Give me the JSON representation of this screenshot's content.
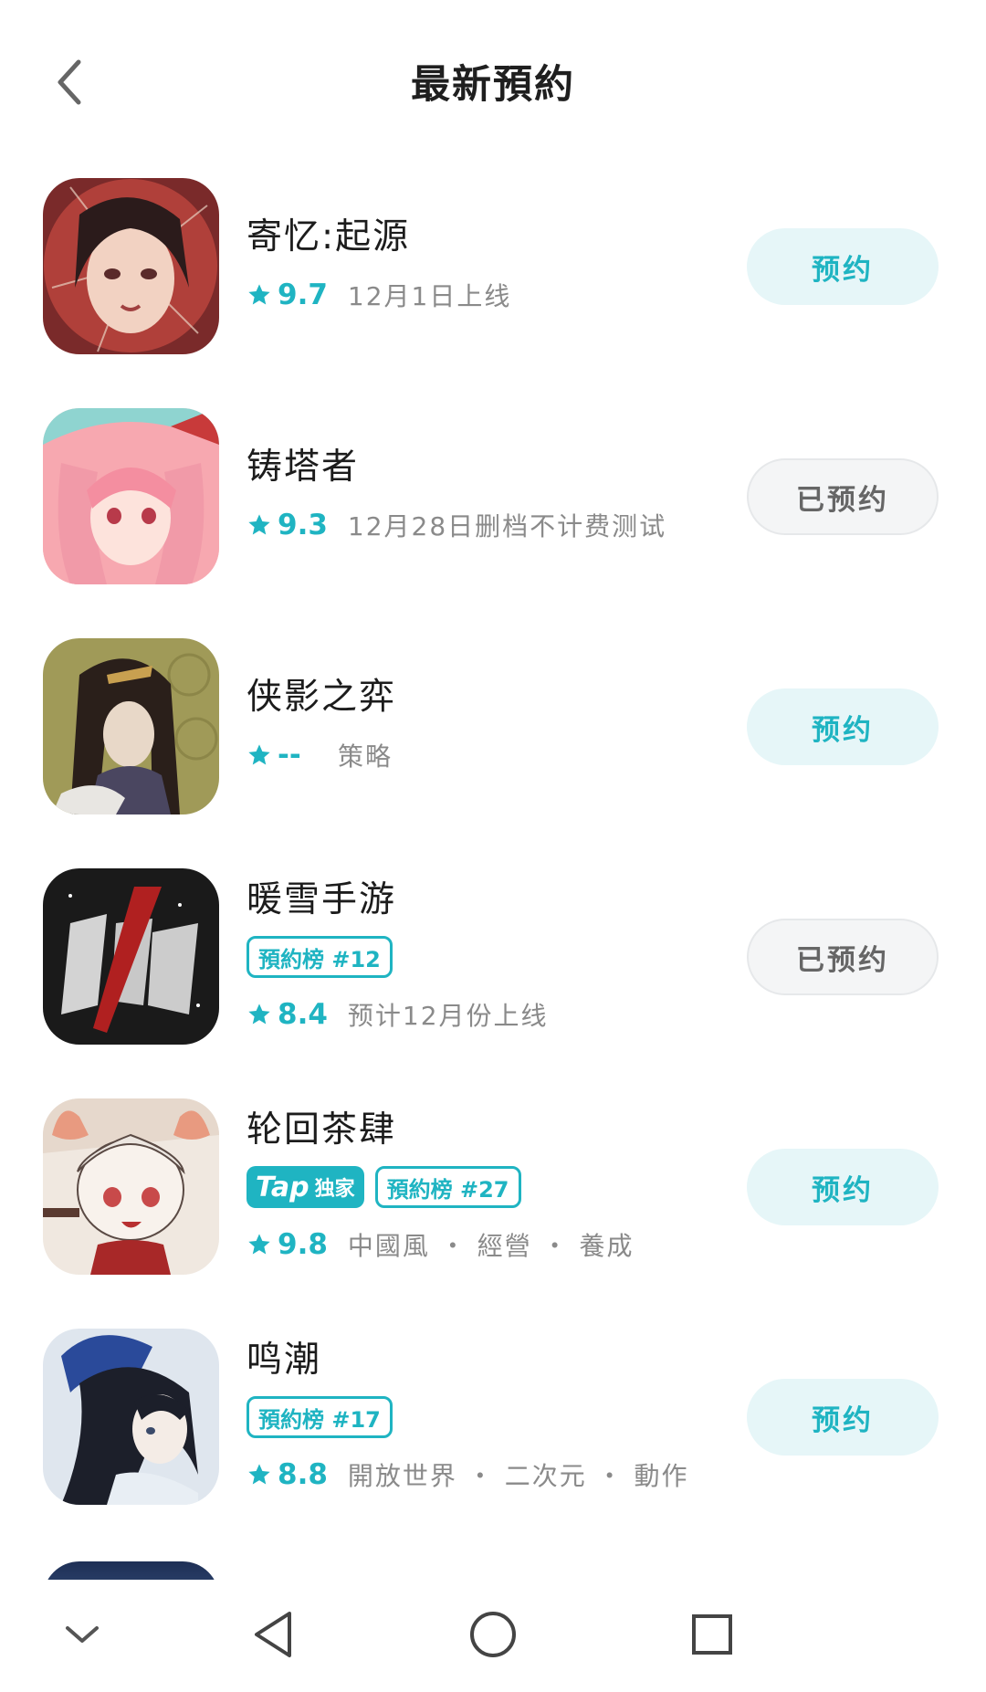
{
  "header": {
    "title": "最新預約",
    "back_icon": "chevron-left-icon"
  },
  "colors": {
    "accent": "#1fb4c2",
    "reserve_bg": "#e6f6f8",
    "reserved_bg": "#f4f5f6",
    "muted_text": "#8a8a8a"
  },
  "apps": [
    {
      "name": "寄忆:起源",
      "rating": "9.7",
      "meta": "12月1日上线",
      "button": "预约"
    },
    {
      "name": "铸塔者",
      "rating": "9.3",
      "meta": "12月28日删档不计费测试",
      "button": "已预约"
    },
    {
      "name": "侠影之弈",
      "rating": "--",
      "meta": "策略",
      "button": "预约"
    },
    {
      "name": "暖雪手游",
      "rank_tag": "預約榜 #12",
      "rating": "8.4",
      "meta": "预计12月份上线",
      "button": "已预约"
    },
    {
      "name": "轮回茶肆",
      "tap_tag": {
        "brand": "Tap",
        "label": "独家"
      },
      "rank_tag": "預約榜 #27",
      "rating": "9.8",
      "meta": "中國風 ・ 經營 ・ 養成",
      "button": "预约"
    },
    {
      "name": "鸣潮",
      "rank_tag": "預約榜 #17",
      "rating": "8.8",
      "meta": "開放世界 ・ 二次元 ・ 動作",
      "button": "预约"
    }
  ],
  "navbar": {
    "items": [
      "collapse-icon",
      "back-triangle-icon",
      "home-circle-icon",
      "recents-square-icon"
    ]
  }
}
